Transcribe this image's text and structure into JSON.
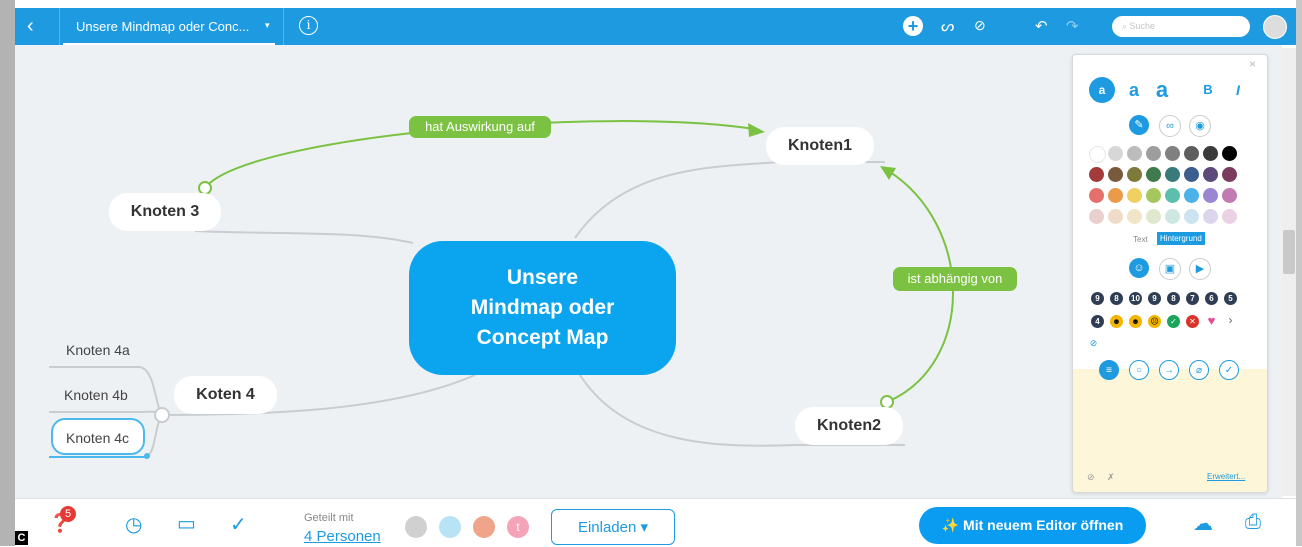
{
  "topbar": {
    "title": "Unsere Mindmap oder Conc...",
    "search_placeholder": "Suche"
  },
  "mindmap": {
    "center": [
      "Unsere",
      "Mindmap oder",
      "Concept Map"
    ],
    "nodes": {
      "knoten1": "Knoten1",
      "knoten2": "Knoten2",
      "knoten3": "Knoten 3",
      "knoten4": "Koten 4",
      "knoten4a": "Knoten 4a",
      "knoten4b": "Knoten 4b",
      "knoten4c": "Knoten 4c"
    },
    "relations": {
      "r1": "hat Auswirkung auf",
      "r2": "ist abhängig von"
    }
  },
  "panel": {
    "font_sizes": [
      "a",
      "a",
      "a"
    ],
    "bold": "B",
    "italic": "I",
    "text_tab": "Text",
    "background_tab": "Hintergrund",
    "numbers": [
      "9",
      "8",
      "10",
      "9",
      "8",
      "7",
      "6",
      "5",
      "4"
    ],
    "more_link": "Erweitert...",
    "colors": {
      "accent": "#1e9be0",
      "swatches": [
        [
          "#ffffff",
          "#d7d7d7",
          "#bcbcbc",
          "#9d9d9d",
          "#808080",
          "#5e5e5e",
          "#3a3a3a",
          "#000000"
        ],
        [
          "#a33b3b",
          "#7a5a3d",
          "#7d7a3b",
          "#3e7a4b",
          "#3b7a7a",
          "#3b5e8e",
          "#5c4a7a",
          "#7a3b5e"
        ],
        [
          "#e5706b",
          "#eb9a4a",
          "#f0d062",
          "#a5c85e",
          "#5cbfae",
          "#4cb2e8",
          "#9b87d1",
          "#c17bb1"
        ],
        [
          "#e9d0cf",
          "#efdcc8",
          "#f0e5c6",
          "#dfe8cf",
          "#cfe7e2",
          "#cde4f0",
          "#ddd5ee",
          "#ecd0e3"
        ]
      ]
    }
  },
  "bottombar": {
    "badge_count": "5",
    "shared_label": "Geteilt mit",
    "shared_people": "4 Personen",
    "avatar_letter": "t",
    "invite_label": "Einladen",
    "editor_label": "Mit neuem Editor öffnen"
  }
}
